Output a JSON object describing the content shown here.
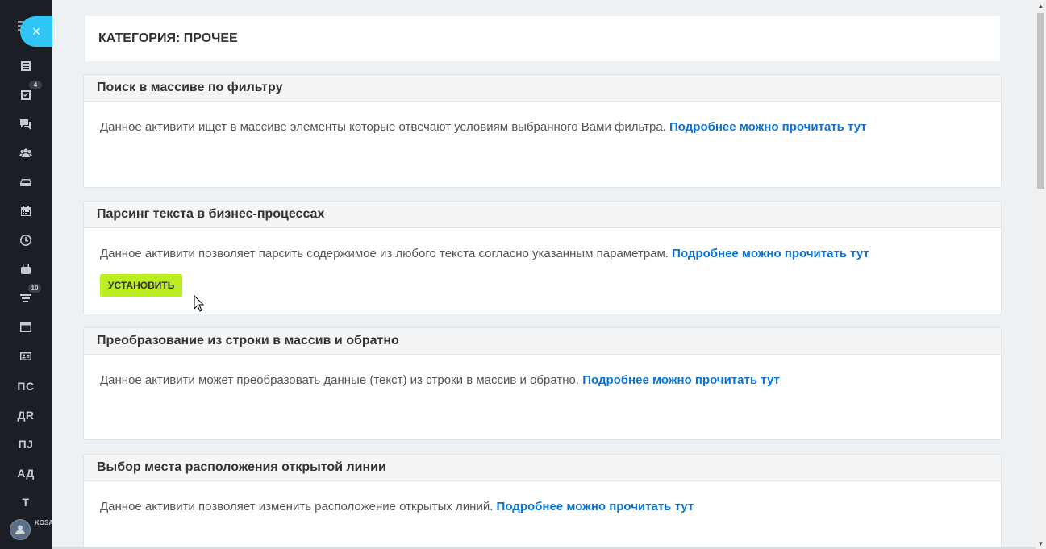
{
  "sidebar": {
    "close_icon": "×",
    "items": [
      {
        "name": "feed",
        "icon": "newspaper-icon"
      },
      {
        "name": "tasks",
        "icon": "checkbox-icon",
        "badge": "4"
      },
      {
        "name": "chat",
        "icon": "chat-icon"
      },
      {
        "name": "groups",
        "icon": "users-icon"
      },
      {
        "name": "drive",
        "icon": "drive-icon"
      },
      {
        "name": "calendar",
        "icon": "calendar-icon"
      },
      {
        "name": "time",
        "icon": "clock-icon"
      },
      {
        "name": "robots",
        "icon": "robot-icon"
      },
      {
        "name": "crm",
        "icon": "funnel-icon",
        "badge": "10"
      },
      {
        "name": "sites",
        "icon": "window-icon"
      },
      {
        "name": "contacts",
        "icon": "contact-card-icon"
      }
    ],
    "text_items": [
      "ПС",
      "ДR",
      "ПJ",
      "АД",
      "Т"
    ],
    "avatar_label": "KOSA ВСЁ Б"
  },
  "category": {
    "title": "КАТЕГОРИЯ: ПРОЧЕЕ"
  },
  "cards": [
    {
      "title": "Поиск в массиве по фильтру",
      "text": "Данное активити ищет в массиве элементы которые отвечают условиям выбранного Вами фильтра.",
      "link": "Подробнее можно прочитать тут"
    },
    {
      "title": "Парсинг текста в бизнес-процессах",
      "text": "Данное активити позволяет парсить содержимое из любого текста согласно указанным параметрам.",
      "link": "Подробнее можно прочитать тут",
      "button": "УСТАНОВИТЬ"
    },
    {
      "title": "Преобразование из строки в массив и обратно",
      "text": "Данное активити может преобразовать данные (текст) из строки в массив и обратно.",
      "link": "Подробнее можно прочитать тут"
    },
    {
      "title": "Выбор места расположения открытой линии",
      "text": "Данное активити позволяет изменить расположение открытых линий.",
      "link": "Подробнее можно прочитать тут"
    }
  ],
  "scrollbar": {
    "up_icon": "▲",
    "down_icon": "▼"
  },
  "colors": {
    "accent": "#2fc6f6",
    "link": "#0b73d6",
    "install": "#bbed21",
    "sidebar": "#1b1e24"
  }
}
